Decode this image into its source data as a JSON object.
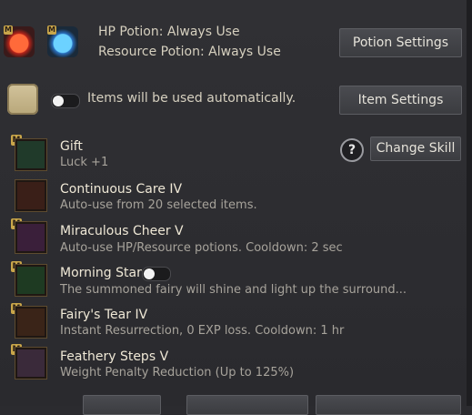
{
  "potions": {
    "hp_label": "HP Potion: Always Use",
    "resource_label": "Resource Potion: Always Use",
    "settings_button": "Potion Settings",
    "hp_icon": "red-potion-icon",
    "resource_icon": "blue-potion-icon"
  },
  "items": {
    "auto_text": "Items will be used automatically.",
    "settings_button": "Item Settings",
    "toggle_on": false
  },
  "skill_header": {
    "change_skill_button": "Change Skill",
    "help_symbol": "?"
  },
  "skills": [
    {
      "title": "Gift",
      "desc": "Luck +1",
      "badge": "M"
    },
    {
      "title": "Continuous Care IV",
      "desc": "Auto-use from 20 selected items.",
      "badge": ""
    },
    {
      "title": "Miraculous Cheer V",
      "desc": "Auto-use HP/Resource potions. Cooldown: 2 sec",
      "badge": "M"
    },
    {
      "title": "Morning Star",
      "desc": "The summoned fairy will shine and light up the surround...",
      "badge": "M"
    },
    {
      "title": "Fairy's Tear IV",
      "desc": "Instant Resurrection, 0 EXP loss. Cooldown: 1 hr",
      "badge": "M"
    },
    {
      "title": "Feathery Steps V",
      "desc": "Weight Penalty Reduction (Up to 125%)",
      "badge": "M"
    }
  ],
  "colors": {
    "background": "#2b2b2f",
    "badge": "#c9a64a"
  }
}
